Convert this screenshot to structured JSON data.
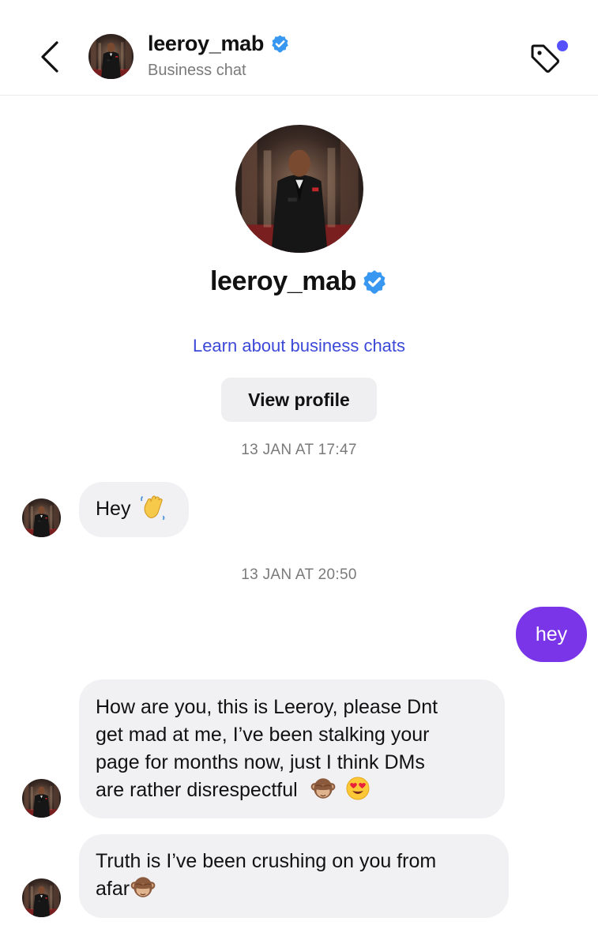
{
  "header": {
    "username": "leeroy_mab",
    "subtitle": "Business chat",
    "back_icon": "chevron-left-icon",
    "tag_icon": "tag-icon",
    "unread_dot_color": "#5551ff"
  },
  "profile": {
    "username": "leeroy_mab",
    "verified": true,
    "learn_link": "Learn about business chats",
    "view_profile_label": "View profile"
  },
  "messages": [
    {
      "type": "timestamp",
      "text": "13 JAN AT 17:47"
    },
    {
      "type": "incoming",
      "text": "Hey",
      "emoji": [
        "waving-hand-emoji"
      ]
    },
    {
      "type": "timestamp",
      "text": "13 JAN AT 20:50"
    },
    {
      "type": "outgoing",
      "text": "hey"
    },
    {
      "type": "incoming",
      "lines": [
        "How are you, this is Leeroy, please Dnt",
        "get mad at me, I’ve been stalking your",
        "page for months now, just I think DMs",
        "are rather disrespectful"
      ],
      "emoji": [
        "see-no-evil-monkey-emoji",
        "heart-eyes-emoji"
      ]
    },
    {
      "type": "incoming",
      "lines": [
        "Truth is I’ve been crushing on you from",
        "afar"
      ],
      "emoji": [
        "see-no-evil-monkey-emoji"
      ]
    }
  ],
  "colors": {
    "accent": "#7b35e8",
    "link": "#3d49d8",
    "verified": "#3897f0",
    "bubble_in": "#f1f1f3"
  }
}
